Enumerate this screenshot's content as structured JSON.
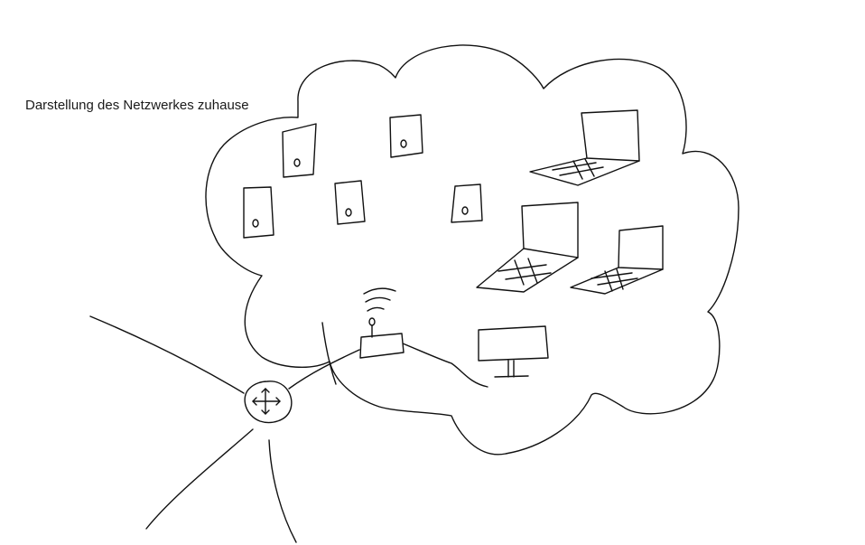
{
  "diagram": {
    "caption": "Darstellung des Netzwerkes zuhause"
  }
}
